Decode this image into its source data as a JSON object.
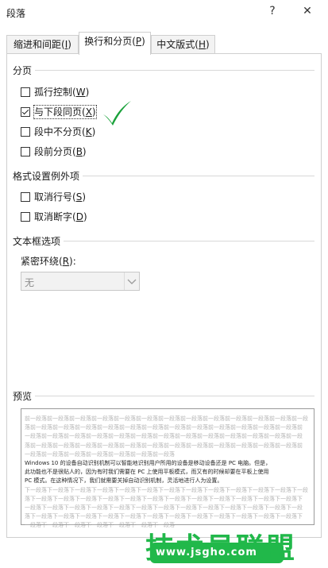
{
  "window": {
    "title": "段落",
    "help_glyph": "?",
    "close_glyph": "✕"
  },
  "tabs": [
    {
      "label_pre": "缩进和间距(",
      "key": "I",
      "label_post": ")"
    },
    {
      "label_pre": "换行和分页(",
      "key": "P",
      "label_post": ")"
    },
    {
      "label_pre": "中文版式(",
      "key": "H",
      "label_post": ")"
    }
  ],
  "pagination": {
    "title": "分页",
    "items": [
      {
        "label_pre": "孤行控制(",
        "key": "W",
        "label_post": ")",
        "checked": false
      },
      {
        "label_pre": "与下段同页(",
        "key": "X",
        "label_post": ")",
        "checked": true
      },
      {
        "label_pre": "段中不分页(",
        "key": "K",
        "label_post": ")",
        "checked": false
      },
      {
        "label_pre": "段前分页(",
        "key": "B",
        "label_post": ")",
        "checked": false
      }
    ]
  },
  "exceptions": {
    "title": "格式设置例外项",
    "items": [
      {
        "label_pre": "取消行号(",
        "key": "S",
        "label_post": ")",
        "checked": false
      },
      {
        "label_pre": "取消断字(",
        "key": "D",
        "label_post": ")",
        "checked": false
      }
    ]
  },
  "textbox": {
    "title": "文本框选项",
    "wrap_label_pre": "紧密环绕(",
    "wrap_key": "R",
    "wrap_label_post": "):",
    "wrap_value": "无"
  },
  "preview": {
    "title": "预览",
    "lines": [
      {
        "text": "前一段落前一段落前一段落前一段落前一段落前一段落前一段落前一段落前一段落前一段落前一段落前一段落前一段",
        "style": "gray"
      },
      {
        "text": "落前一段落前一段落前一段落前一段落前一段落前一段落前一段落前一段落前一段落前一段落前一段落前一段落前",
        "style": "gray"
      },
      {
        "text": "一段落前一段落前一段落前一段落前一段落前一段落前一段落前一段落前一段落前一段落前一段落前一段落前一段",
        "style": "gray"
      },
      {
        "text": "落前一段落前一段落前一段落前一段落前一段落前一段落前一段落前一段落前一段落前一段落前一段落前一段落前",
        "style": "gray"
      },
      {
        "text": "一段落前一段落前一段落前一段落前一段落前一段落前一段落",
        "style": "gray"
      },
      {
        "text": "Windows 10 的设备自动识别机制可以智能地识别用户所用的设备是移动设备还是 PC 电脑。但是，",
        "style": "dark"
      },
      {
        "text": "此功能也不是很贴人的，因为有时我们需要在 PC 上使用平板模式，而又有的时候却要在平板上使用",
        "style": "dark"
      },
      {
        "text": "PC 模式。在这种情况下，我们就需要关掉自动识别机制，灵活地进行人为设置。",
        "style": "dark"
      },
      {
        "text": "下一段落下一段落下一段落下一段落下一段落下一段落下一段落下一段落下一段落下一段落下一段落下一段落下一段",
        "style": "gray"
      },
      {
        "text": "落下一段落下一段落下一段落下一段落下一段落下一段落下一段落下一段落下一段落下一段落下一段落下一段落下",
        "style": "gray"
      },
      {
        "text": "一段落下一段落下一段落下一段落下一段落下一段落下一段落下一段落下一段落下一段落下一段落下一段落下一段",
        "style": "gray"
      },
      {
        "text": "落下一段落下一段落下一段落下一段落下一段落下一段落下一段落下一段落下一段落下一段落下一段落下一段落下",
        "style": "gray"
      },
      {
        "text": "一段落下一段落下一段落下一段落下一段落下一段落下一段落",
        "style": "gray"
      }
    ]
  },
  "watermark": {
    "text": "技术员联盟",
    "url": "www.jsgho.com"
  },
  "colors": {
    "accent_check": "#19a13a",
    "watermark": "#21b84a",
    "focus_outline": "#333333"
  }
}
